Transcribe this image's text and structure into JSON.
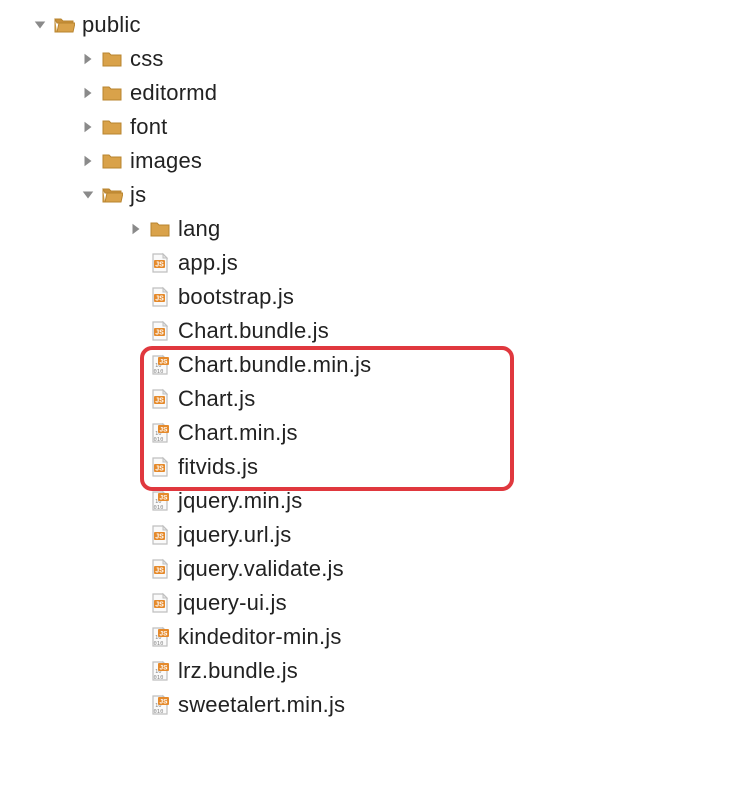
{
  "icons": {
    "folder_fill": "#d9a24a",
    "folder_stroke": "#b8842f",
    "js_badge_bg": "#e58a2c",
    "js_badge_text": "#fff",
    "file_stroke": "#bfbfbf",
    "file_fill": "#fafafa",
    "binary_digits": "10\n010"
  },
  "highlight": {
    "color": "#e0383e",
    "items": [
      "Chart.bundle.js",
      "Chart.bundle.min.js",
      "Chart.js",
      "Chart.min.js"
    ]
  },
  "tree": [
    {
      "depth": 0,
      "arrow": "down",
      "icon": "folder-open",
      "label": "public"
    },
    {
      "depth": 1,
      "arrow": "right",
      "icon": "folder",
      "label": "css"
    },
    {
      "depth": 1,
      "arrow": "right",
      "icon": "folder",
      "label": "editormd"
    },
    {
      "depth": 1,
      "arrow": "right",
      "icon": "folder",
      "label": "font"
    },
    {
      "depth": 1,
      "arrow": "right",
      "icon": "folder",
      "label": "images"
    },
    {
      "depth": 1,
      "arrow": "down",
      "icon": "folder-open",
      "label": "js"
    },
    {
      "depth": 2,
      "arrow": "right",
      "icon": "folder",
      "label": "lang"
    },
    {
      "depth": 2,
      "arrow": "none",
      "icon": "file-js",
      "label": "app.js"
    },
    {
      "depth": 2,
      "arrow": "none",
      "icon": "file-js",
      "label": "bootstrap.js"
    },
    {
      "depth": 2,
      "arrow": "none",
      "icon": "file-js",
      "label": "Chart.bundle.js"
    },
    {
      "depth": 2,
      "arrow": "none",
      "icon": "file-js-min",
      "label": "Chart.bundle.min.js"
    },
    {
      "depth": 2,
      "arrow": "none",
      "icon": "file-js",
      "label": "Chart.js"
    },
    {
      "depth": 2,
      "arrow": "none",
      "icon": "file-js-min",
      "label": "Chart.min.js"
    },
    {
      "depth": 2,
      "arrow": "none",
      "icon": "file-js",
      "label": "fitvids.js"
    },
    {
      "depth": 2,
      "arrow": "none",
      "icon": "file-js-min",
      "label": "jquery.min.js"
    },
    {
      "depth": 2,
      "arrow": "none",
      "icon": "file-js",
      "label": "jquery.url.js"
    },
    {
      "depth": 2,
      "arrow": "none",
      "icon": "file-js",
      "label": "jquery.validate.js"
    },
    {
      "depth": 2,
      "arrow": "none",
      "icon": "file-js",
      "label": "jquery-ui.js"
    },
    {
      "depth": 2,
      "arrow": "none",
      "icon": "file-js-min",
      "label": "kindeditor-min.js"
    },
    {
      "depth": 2,
      "arrow": "none",
      "icon": "file-js-min",
      "label": "lrz.bundle.js"
    },
    {
      "depth": 2,
      "arrow": "none",
      "icon": "file-js-min",
      "label": "sweetalert.min.js"
    }
  ]
}
